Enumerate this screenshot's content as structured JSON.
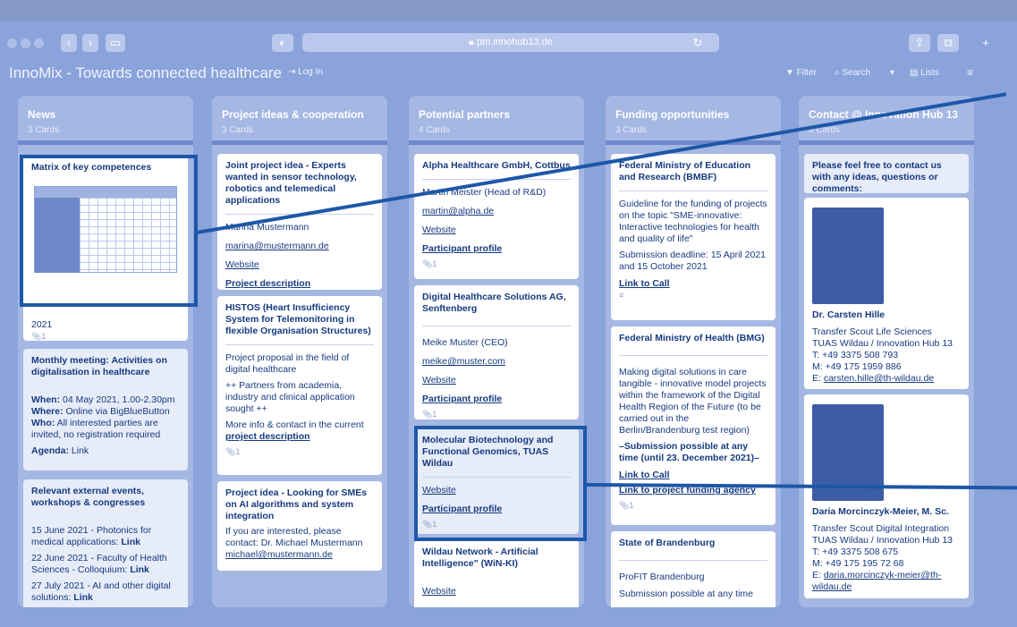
{
  "browser": {
    "url": "pm.innohub13.de"
  },
  "app": {
    "title": "InnoMix - Towards connected healthcare",
    "login": "Log In",
    "filter": "Filter",
    "search": "Search",
    "lists": "Lists"
  },
  "columns": [
    {
      "title": "News",
      "count": "3 Cards",
      "cards": [
        {
          "title": "Matrix of key competences",
          "tail": "2021"
        },
        {
          "title": "Monthly meeting: Activities on digitalisation in healthcare",
          "when_label": "When:",
          "when": "04 May 2021, 1.00-2.30pm",
          "where_label": "Where:",
          "where": "Online via BigBlueButton",
          "who_label": "Who:",
          "who": "All interested parties are invited, no registration required",
          "agenda_label": "Agenda:",
          "agenda": "Link"
        },
        {
          "title": "Relevant external events, workshops & congresses",
          "e1": "15 June 2021 - Photonics for medical applications:",
          "e1_link": "Link",
          "e2": "22 June 2021 - Faculty of Health Sciences - Colloquium:",
          "e2_link": "Link",
          "e3": "27 July 2021 - AI and other digital solutions:",
          "e3_link": "Link"
        }
      ]
    },
    {
      "title": "Project ideas & cooperation",
      "count": "3 Cards",
      "cards": [
        {
          "title": "Joint project idea - Experts wanted in sensor technology, robotics and telemedical applications",
          "name": "Marina Mustermann",
          "email": "marina@mustermann.de",
          "website": "Website",
          "desc": "Project description"
        },
        {
          "title": "HISTOS (Heart Insufficiency System for Telemonitoring in flexible Organisation Structures)",
          "p1": "Project proposal in the field of digital healthcare",
          "p2": "++ Partners from academia, industry and clinical application sought ++",
          "p3": "More info & contact in the current",
          "p3_link": "project description"
        },
        {
          "title": "Project idea - Looking for SMEs on AI algorithms and system integration",
          "p1": "If you are interested, please contact: Dr. Michael Mustermann",
          "email": "michael@mustermann.de"
        }
      ]
    },
    {
      "title": "Potential partners",
      "count": "4 Cards",
      "cards": [
        {
          "title": "Alpha Healthcare GmbH, Cottbus",
          "person": "Martin Meister (Head of R&D)",
          "email": "martin@alpha.de",
          "website": "Website",
          "profile": "Participant profile"
        },
        {
          "title": "Digital Healthcare Solutions AG, Senftenberg",
          "person": "Meike Muster (CEO)",
          "email": "meike@muster.com",
          "website": "Website",
          "profile": "Participant profile"
        },
        {
          "title": "Molecular Biotechnology and Functional Genomics, TUAS Wildau",
          "website": "Website",
          "profile": "Participant profile"
        },
        {
          "title": "Wildau Network - Artificial Intelligence\" (WiN-KI)",
          "website": "Website"
        }
      ]
    },
    {
      "title": "Funding opportunities",
      "count": "3 Cards",
      "cards": [
        {
          "title": "Federal Ministry of Education and Research (BMBF)",
          "p1": "Guideline for the funding of projects on the topic \"SME-innovative: Interactive technologies for health and quality of life\"",
          "p2": "Submission deadline: 15 April 2021 and 15 October 2021",
          "link": "Link to Call"
        },
        {
          "title": "Federal Ministry of Health (BMG)",
          "p1": "Making digital solutions in care tangible - innovative model projects within the framework of the Digital Health Region of the Future (to be carried out in the Berlin/Brandenburg test region)",
          "p2": "–Submission possible at any time (until 23. December 2021)–",
          "link1": "Link to Call",
          "link2": "Link to project funding agency"
        },
        {
          "title": "State of Brandenburg",
          "p1": "ProFIT Brandenburg",
          "p2": "Submission possible at any time"
        }
      ]
    },
    {
      "title": "Contact @ Innovation Hub 13",
      "count": "3 Cards",
      "cards": [
        {
          "title": "Please feel free to contact us with any ideas, questions or comments:"
        },
        {
          "name": "Dr. Carsten Hille",
          "role": "Transfer Scout Life Sciences",
          "org": "TUAS Wildau / Innovation Hub 13",
          "tel": "T: +49 3375 508 793",
          "mob": "M: +49 175 1959 886",
          "email_label": "E:",
          "email": "carsten.hille@th-wildau.de"
        },
        {
          "name": "Daria Morcinczyk-Meier, M. Sc.",
          "role": "Transfer Scout Digital Integration",
          "org": "TUAS Wildau / Innovation Hub 13",
          "tel": "T: +49 3375 508 675",
          "mob": "M: +49 175 195 72 68",
          "email_label": "E:",
          "email": "daria.morcinczyk-meier@th-wildau.de"
        }
      ]
    }
  ],
  "colors": {
    "background": "#8099d6",
    "column": "#a5b7e3",
    "card_text": "#173a80",
    "highlight": "#1d57a8"
  }
}
